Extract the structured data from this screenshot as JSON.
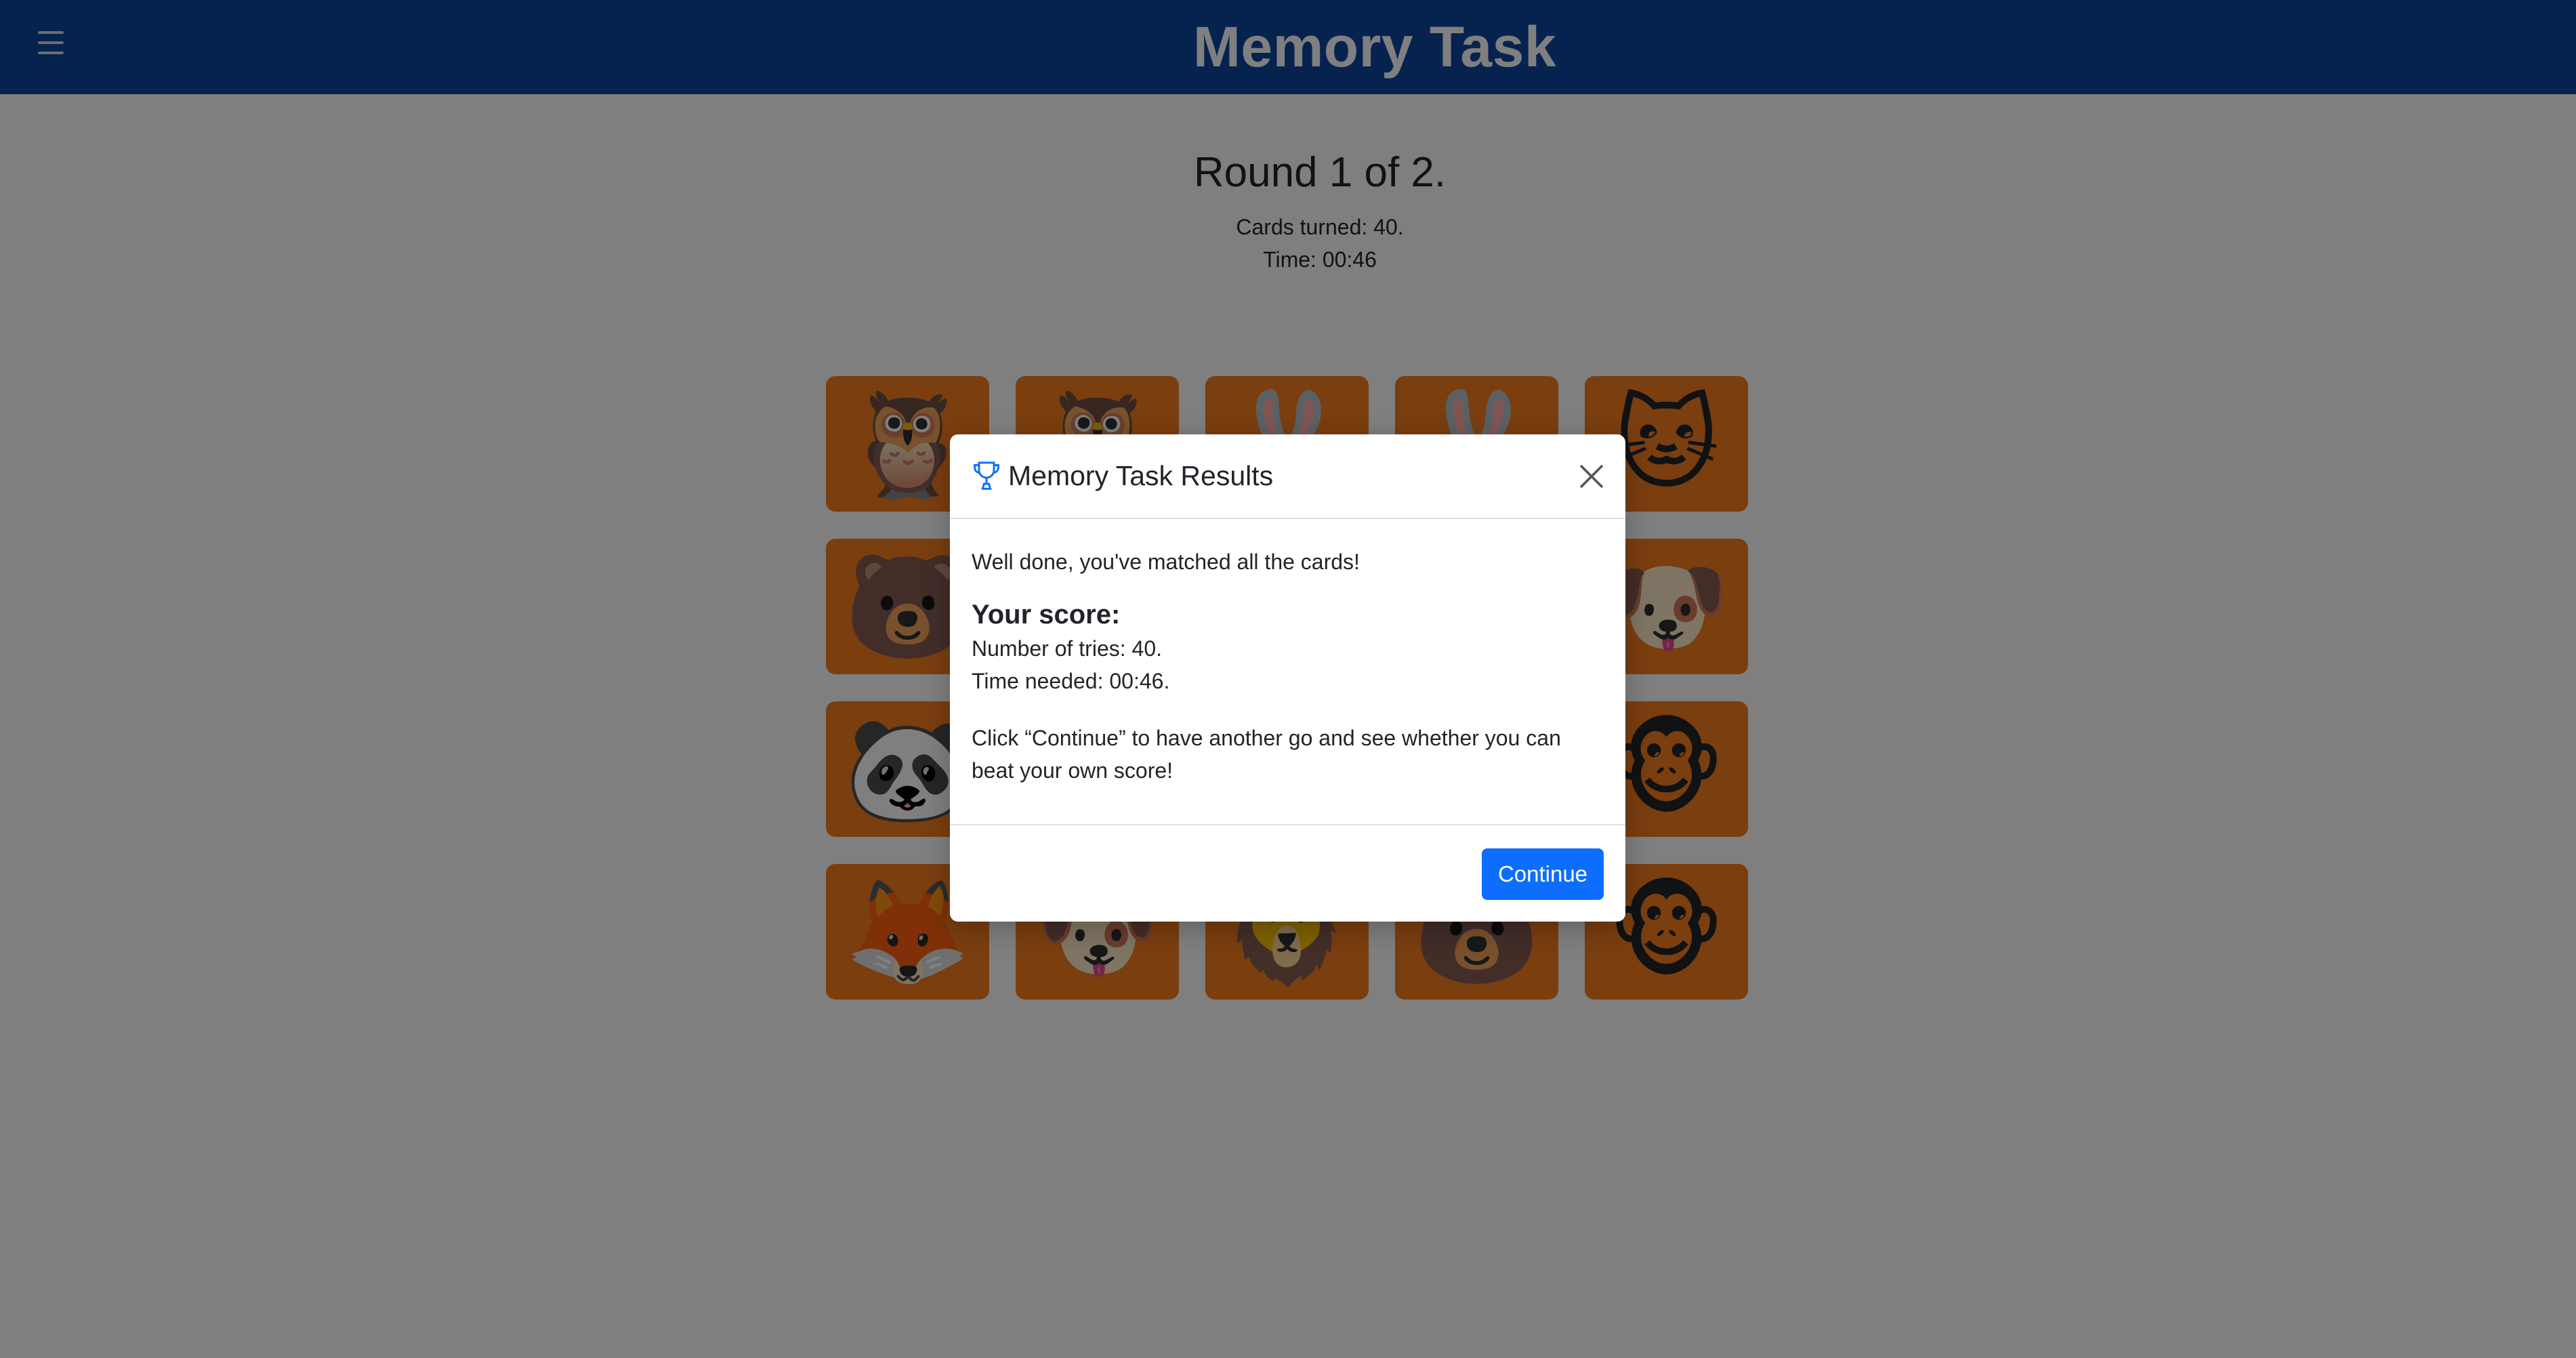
{
  "navbar": {
    "title": "Memory Task",
    "menu_icon": "hamburger-menu-icon"
  },
  "game": {
    "round_title": "Round 1 of 2.",
    "cards_turned": "Cards turned: 40.",
    "time": "Time: 00:46",
    "cards": [
      {
        "animal": "owl-icon",
        "glyph": "🦉"
      },
      {
        "animal": "owl-icon",
        "glyph": "🦉"
      },
      {
        "animal": "rabbit-icon",
        "glyph": "🐰"
      },
      {
        "animal": "rabbit-icon",
        "glyph": "🐰"
      },
      {
        "animal": "cat-icon",
        "glyph": "🐱"
      },
      {
        "animal": "bear-icon",
        "glyph": "🐻"
      },
      {
        "animal": "hidden",
        "glyph": ""
      },
      {
        "animal": "hidden",
        "glyph": ""
      },
      {
        "animal": "hidden",
        "glyph": ""
      },
      {
        "animal": "dog-icon",
        "glyph": "🐶"
      },
      {
        "animal": "panda-icon",
        "glyph": "🐼"
      },
      {
        "animal": "hidden",
        "glyph": ""
      },
      {
        "animal": "hidden",
        "glyph": ""
      },
      {
        "animal": "hidden",
        "glyph": ""
      },
      {
        "animal": "monkey-icon",
        "glyph": "🐵"
      },
      {
        "animal": "fox-icon",
        "glyph": "🦊"
      },
      {
        "animal": "dog-icon",
        "glyph": "🐶"
      },
      {
        "animal": "lion-icon",
        "glyph": "🦁"
      },
      {
        "animal": "bear-icon",
        "glyph": "🐻"
      },
      {
        "animal": "monkey-icon",
        "glyph": "🐵"
      }
    ]
  },
  "modal": {
    "title": "Memory Task Results",
    "icon": "trophy-icon",
    "message": "Well done, you've matched all the cards!",
    "score_heading": "Your score:",
    "tries": "Number of tries: 40.",
    "time_needed": "Time needed: 00:46.",
    "hint": "Click “Continue” to have another go and see whether you can beat your own score!",
    "continue_label": "Continue",
    "colors": {
      "primary": "#0d6efd",
      "navbar": "#0d47a1",
      "card": "#f57c1f"
    }
  }
}
